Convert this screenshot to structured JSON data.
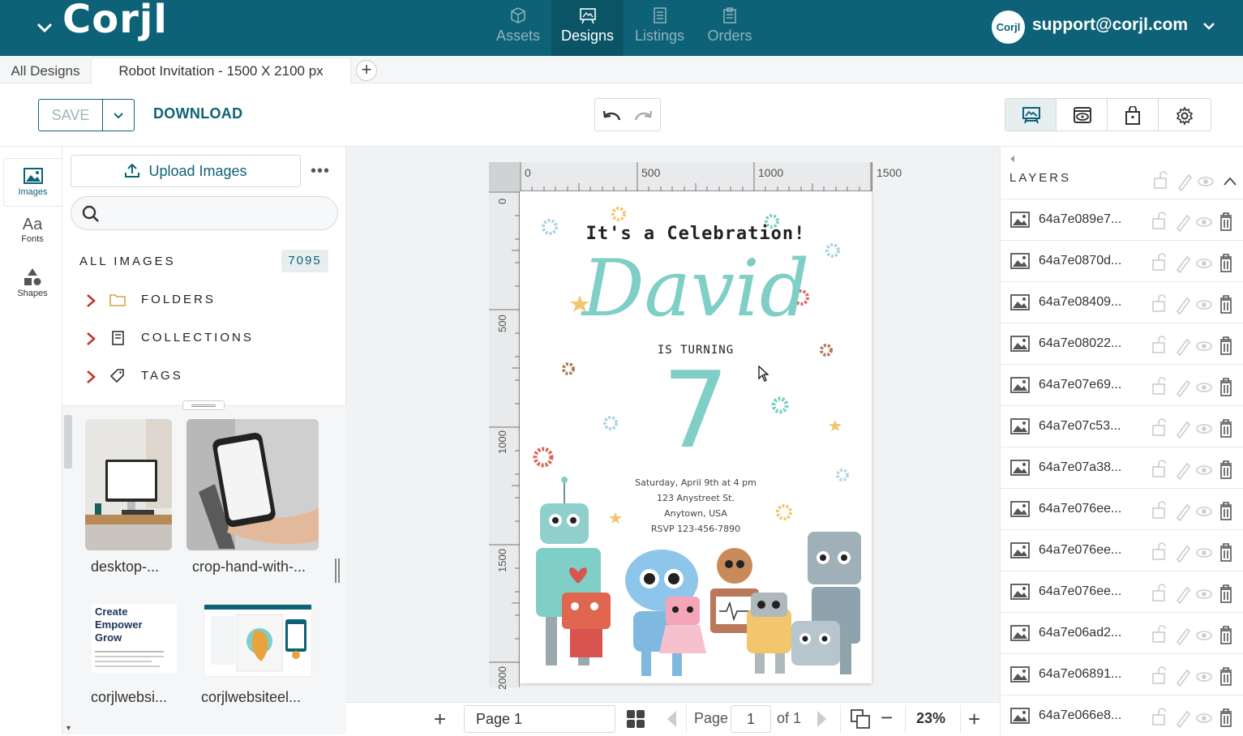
{
  "brand": {
    "logo_text": "Corjl"
  },
  "nav": {
    "tabs": [
      {
        "label": "Assets",
        "icon": "cube-icon"
      },
      {
        "label": "Designs",
        "icon": "design-icon",
        "active": true
      },
      {
        "label": "Listings",
        "icon": "list-icon"
      },
      {
        "label": "Orders",
        "icon": "clipboard-icon"
      }
    ]
  },
  "account": {
    "avatar_text": "Corjl",
    "email": "support@corjl.com"
  },
  "tabs": {
    "all_designs": "All Designs",
    "current": "Robot Invitation - 1500 X 2100 px",
    "add": "+"
  },
  "toolbar": {
    "save_label": "SAVE",
    "download_label": "DOWNLOAD"
  },
  "sidebar": {
    "items": [
      {
        "label": "Images",
        "icon": "image-icon"
      },
      {
        "label": "Fonts",
        "icon": "fonts-icon",
        "glyph": "Aa"
      },
      {
        "label": "Shapes",
        "icon": "shapes-icon"
      }
    ]
  },
  "images_panel": {
    "upload_label": "Upload Images",
    "more_label": "•••",
    "search_placeholder": "",
    "all_images_label": "ALL IMAGES",
    "all_images_count": "7095",
    "tree": [
      {
        "label": "FOLDERS",
        "icon": "folder-icon"
      },
      {
        "label": "COLLECTIONS",
        "icon": "book-icon"
      },
      {
        "label": "TAGS",
        "icon": "tag-icon"
      }
    ],
    "thumbs": [
      {
        "label": "desktop-..."
      },
      {
        "label": "crop-hand-with-..."
      },
      {
        "label": "corjlwebsi...",
        "inner_text": "Create Empower Grow"
      },
      {
        "label": "corjlwebsiteel..."
      }
    ]
  },
  "rulers": {
    "top": [
      "0",
      "500",
      "1000",
      "1500"
    ],
    "left": [
      "0",
      "500",
      "1000",
      "1500",
      "2000"
    ]
  },
  "invitation": {
    "line1": "It's a Celebration!",
    "name": "David",
    "turning": "IS TURNING",
    "age": "7",
    "details": [
      "Saturday, April 9th at 4 pm",
      "123 Anystreet St.",
      "Anytown, USA",
      "RSVP 123-456-7890"
    ]
  },
  "layers": {
    "title": "LAYERS",
    "items": [
      "64a7e089e7...",
      "64a7e0870d...",
      "64a7e08409...",
      "64a7e08022...",
      "64a7e07e69...",
      "64a7e07c53...",
      "64a7e07a38...",
      "64a7e076ee...",
      "64a7e076ee...",
      "64a7e076ee...",
      "64a7e06ad2...",
      "64a7e06891...",
      "64a7e066e8..."
    ]
  },
  "bottombar": {
    "add": "+",
    "page_name": "Page 1",
    "page_label": "Page",
    "page_number": "1",
    "of_label": "of 1",
    "zoom_minus": "−",
    "zoom": "23%",
    "zoom_plus": "+"
  },
  "colors": {
    "brand": "#0e6277",
    "accent_teal": "#7fcfc6",
    "chevron_red": "#c0392b"
  }
}
